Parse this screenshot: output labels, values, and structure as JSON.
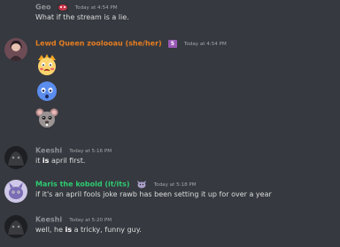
{
  "messages": [
    {
      "author": "Geo",
      "author_color": "#8e9297",
      "timestamp": "Today at 4:54 PM",
      "text": "What if the stream is a lie."
    },
    {
      "author": "Lewd Queen zoolooau (she/her)",
      "author_color": "#e67e22",
      "timestamp": "Today at 4:54 PM",
      "role_badge": "5",
      "emojis": [
        "blushing-face-emoji",
        "blue-ghost-emoji",
        "grey-rat-emoji"
      ]
    },
    {
      "author": "Keeshi",
      "author_color": "#8e9297",
      "timestamp": "Today at 5:16 PM",
      "text_pre": "it ",
      "text_bold": "is",
      "text_post": " april first."
    },
    {
      "author": "Maris the kobold (it/its)",
      "author_color": "#2ecc71",
      "timestamp": "Today at 5:18 PM",
      "text": "if it's an april fools joke rawb has been setting it up for over a year"
    },
    {
      "author": "Keeshi",
      "author_color": "#8e9297",
      "timestamp": "Today at 5:20 PM",
      "text_pre": "well, he ",
      "text_bold": "is",
      "text_post": " a tricky, funny guy."
    }
  ]
}
